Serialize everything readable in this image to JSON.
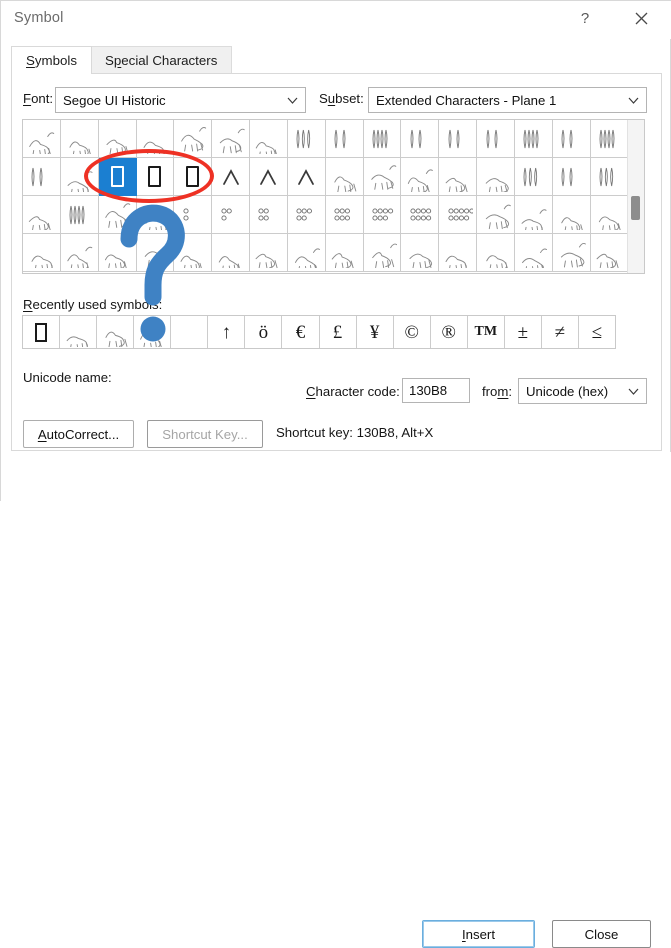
{
  "window": {
    "title": "Symbol",
    "help_icon": "question-mark-icon",
    "close_icon": "close-x-icon"
  },
  "tabs": [
    {
      "label": "Symbols",
      "accel": "S",
      "active": true
    },
    {
      "label": "Special Characters",
      "accel": "p",
      "active": false
    }
  ],
  "fields": {
    "font_label": "Font:",
    "font_accel": "F",
    "font_value": "Segoe UI Historic",
    "subset_label": "Subset:",
    "subset_accel": "u",
    "subset_value": "Extended Characters - Plane 1",
    "dropdown_icon": "chevron-down-icon"
  },
  "glyph_grid": {
    "columns": 16,
    "rows": 4,
    "selected_index": 18,
    "selected_char_code": "130B8",
    "scrollbar": {
      "icon": "vertical-scrollbar",
      "thumb_position_percent": 50
    },
    "cells": [
      {
        "type": "hieroglyph",
        "name": "reed-leaf-low"
      },
      {
        "type": "hieroglyph",
        "name": "reed-flat"
      },
      {
        "type": "hieroglyph",
        "name": "reed-bundle"
      },
      {
        "type": "hieroglyph",
        "name": "reed-mat"
      },
      {
        "type": "hieroglyph",
        "name": "reed-flat-2"
      },
      {
        "type": "hieroglyph",
        "name": "loaf"
      },
      {
        "type": "hieroglyph",
        "name": "loaf-wide"
      },
      {
        "type": "hieroglyph",
        "name": "single-stroke"
      },
      {
        "type": "hieroglyph",
        "name": "double-stroke"
      },
      {
        "type": "hieroglyph",
        "name": "triple-stroke"
      },
      {
        "type": "hieroglyph",
        "name": "quad-stroke"
      },
      {
        "type": "hieroglyph",
        "name": "stroke-cluster-a"
      },
      {
        "type": "hieroglyph",
        "name": "stroke-cluster-b"
      },
      {
        "type": "hieroglyph",
        "name": "stroke-cluster-c"
      },
      {
        "type": "hieroglyph",
        "name": "stroke-cluster-d"
      },
      {
        "type": "hieroglyph",
        "name": "stroke-pair"
      },
      {
        "type": "hieroglyph",
        "name": "coil-row"
      },
      {
        "type": "hieroglyph",
        "name": "reed-low"
      },
      {
        "type": "tofu",
        "name": "missing-glyph-box",
        "selected": true
      },
      {
        "type": "tofu",
        "name": "missing-glyph-box"
      },
      {
        "type": "tofu",
        "name": "missing-glyph-box"
      },
      {
        "type": "hieroglyph",
        "name": "chevron-a"
      },
      {
        "type": "hieroglyph",
        "name": "chevron-b"
      },
      {
        "type": "hieroglyph",
        "name": "chevron-c"
      },
      {
        "type": "hieroglyph",
        "name": "leg-a"
      },
      {
        "type": "hieroglyph",
        "name": "kneeling-figure"
      },
      {
        "type": "hieroglyph",
        "name": "leg-b"
      },
      {
        "type": "hieroglyph",
        "name": "crossed-sticks"
      },
      {
        "type": "hieroglyph",
        "name": "sack"
      },
      {
        "type": "hieroglyph",
        "name": "triple-post-a"
      },
      {
        "type": "hieroglyph",
        "name": "triple-post-b"
      },
      {
        "type": "hieroglyph",
        "name": "double-post"
      },
      {
        "type": "hieroglyph",
        "name": "crocodile"
      },
      {
        "type": "hieroglyph",
        "name": "snake-coil"
      },
      {
        "type": "hieroglyph",
        "name": "lizard"
      },
      {
        "type": "hieroglyph",
        "name": "animal-a"
      },
      {
        "type": "hieroglyph",
        "name": "dots-2"
      },
      {
        "type": "hieroglyph",
        "name": "dots-3"
      },
      {
        "type": "hieroglyph",
        "name": "dots-4"
      },
      {
        "type": "hieroglyph",
        "name": "dots-5"
      },
      {
        "type": "hieroglyph",
        "name": "dots-6"
      },
      {
        "type": "hieroglyph",
        "name": "dots-7"
      },
      {
        "type": "hieroglyph",
        "name": "dots-8"
      },
      {
        "type": "hieroglyph",
        "name": "dots-9"
      },
      {
        "type": "hieroglyph",
        "name": "bull-a"
      },
      {
        "type": "hieroglyph",
        "name": "bull-b"
      },
      {
        "type": "hieroglyph",
        "name": "bull-c"
      },
      {
        "type": "hieroglyph",
        "name": "calf-struck"
      },
      {
        "type": "hieroglyph",
        "name": "cow-calf"
      },
      {
        "type": "hieroglyph",
        "name": "horse"
      },
      {
        "type": "hieroglyph",
        "name": "goat-a"
      },
      {
        "type": "hieroglyph",
        "name": "goat-b"
      },
      {
        "type": "hieroglyph",
        "name": "gazelle"
      },
      {
        "type": "hieroglyph",
        "name": "lying-animal-a"
      },
      {
        "type": "hieroglyph",
        "name": "lying-animal-b"
      },
      {
        "type": "hieroglyph",
        "name": "ibex-a"
      },
      {
        "type": "hieroglyph",
        "name": "ibex-b"
      },
      {
        "type": "hieroglyph",
        "name": "ox"
      },
      {
        "type": "hieroglyph",
        "name": "seated-dog"
      },
      {
        "type": "hieroglyph",
        "name": "standing-animal"
      },
      {
        "type": "hieroglyph",
        "name": "animal-on-stand"
      },
      {
        "type": "hieroglyph",
        "name": "animal-shrine-a"
      },
      {
        "type": "hieroglyph",
        "name": "animal-shrine-b"
      },
      {
        "type": "hieroglyph",
        "name": "jackal"
      }
    ]
  },
  "recent": {
    "label": "Recently used symbols:",
    "accel": "R",
    "symbols": [
      {
        "glyph": "",
        "name": "missing-glyph-box"
      },
      {
        "glyph": "",
        "name": "hieroglyph-kneeling-figure"
      },
      {
        "glyph": "",
        "name": "hieroglyph-stacked-lines"
      },
      {
        "glyph": "",
        "name": "hieroglyph-y-with-ring"
      },
      {
        "glyph": "",
        "name": "blank-cell"
      },
      {
        "glyph": "↑",
        "name": "up-arrow-symbol"
      },
      {
        "glyph": "ö",
        "name": "o-umlaut-symbol"
      },
      {
        "glyph": "€",
        "name": "euro-sign-symbol"
      },
      {
        "glyph": "£",
        "name": "pound-sign-symbol"
      },
      {
        "glyph": "¥",
        "name": "yen-sign-symbol"
      },
      {
        "glyph": "©",
        "name": "copyright-sign-symbol"
      },
      {
        "glyph": "®",
        "name": "registered-sign-symbol"
      },
      {
        "glyph": "TM",
        "name": "trademark-sign-symbol"
      },
      {
        "glyph": "±",
        "name": "plus-minus-sign-symbol"
      },
      {
        "glyph": "≠",
        "name": "not-equal-sign-symbol"
      },
      {
        "glyph": "≤",
        "name": "less-than-or-equal-sign-symbol"
      }
    ]
  },
  "details": {
    "unicode_name_label": "Unicode name:",
    "unicode_name_value": "",
    "character_code_label": "Character code:",
    "character_code_accel": "C",
    "character_code_value": "130B8",
    "from_label": "from:",
    "from_accel": "m",
    "from_value": "Unicode (hex)"
  },
  "actions": {
    "autocorrect_label": "AutoCorrect...",
    "autocorrect_accel": "A",
    "shortcut_key_label": "Shortcut Key...",
    "shortcut_key_disabled": true,
    "shortcut_status": "Shortcut key: 130B8, Alt+X",
    "insert_label": "Insert",
    "insert_accel": "I",
    "close_label": "Close"
  },
  "annotations": {
    "red_ellipse": {
      "name": "red-ellipse-highlight",
      "color": "#ee3124"
    },
    "blue_question_mark": {
      "name": "blue-question-mark-annotation",
      "color": "#3f82c4"
    }
  }
}
